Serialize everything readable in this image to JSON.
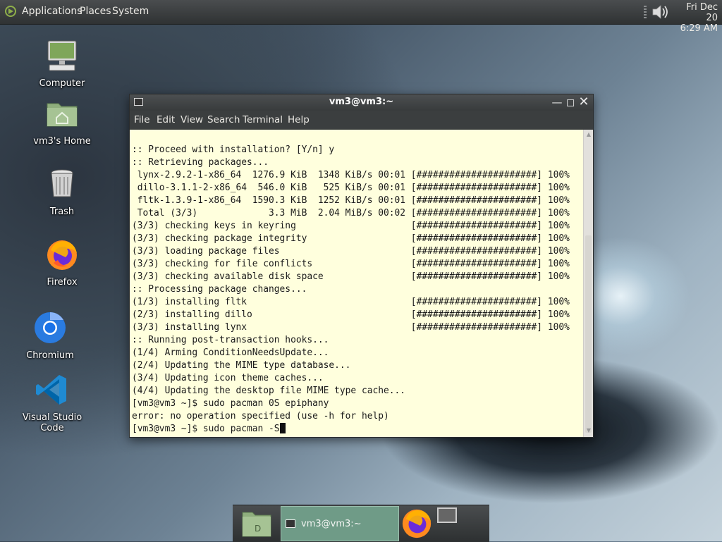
{
  "top_panel": {
    "menus": [
      "Applications",
      "Places",
      "System"
    ],
    "clock_day": "Fri Dec 20",
    "clock_time": "6:29 AM"
  },
  "desktop_icons": [
    {
      "label": "Computer",
      "icon": "computer-icon"
    },
    {
      "label": "vm3's Home",
      "icon": "home-folder-icon"
    },
    {
      "label": "Trash",
      "icon": "trash-icon"
    },
    {
      "label": "Firefox",
      "icon": "firefox-icon"
    },
    {
      "label": "Chromium",
      "icon": "chromium-icon"
    },
    {
      "label": "Visual Studio Code",
      "icon": "vscode-icon"
    }
  ],
  "terminal": {
    "title": "vm3@vm3:~",
    "menu": [
      "File",
      "Edit",
      "View",
      "Search",
      "Terminal",
      "Help"
    ],
    "lines": [
      ":: Proceed with installation? [Y/n] y",
      ":: Retrieving packages...",
      " lynx-2.9.2-1-x86_64  1276.9 KiB  1348 KiB/s 00:01 [######################] 100%",
      " dillo-3.1.1-2-x86_64  546.0 KiB   525 KiB/s 00:01 [######################] 100%",
      " fltk-1.3.9-1-x86_64  1590.3 KiB  1252 KiB/s 00:01 [######################] 100%",
      " Total (3/3)             3.3 MiB  2.04 MiB/s 00:02 [######################] 100%",
      "(3/3) checking keys in keyring                     [######################] 100%",
      "(3/3) checking package integrity                   [######################] 100%",
      "(3/3) loading package files                        [######################] 100%",
      "(3/3) checking for file conflicts                  [######################] 100%",
      "(3/3) checking available disk space                [######################] 100%",
      ":: Processing package changes...",
      "(1/3) installing fltk                              [######################] 100%",
      "(2/3) installing dillo                             [######################] 100%",
      "(3/3) installing lynx                              [######################] 100%",
      ":: Running post-transaction hooks...",
      "(1/4) Arming ConditionNeedsUpdate...",
      "(2/4) Updating the MIME type database...",
      "(3/4) Updating icon theme caches...",
      "(4/4) Updating the desktop file MIME type cache...",
      "[vm3@vm3 ~]$ sudo pacman 0S epiphany",
      "error: no operation specified (use -h for help)"
    ],
    "prompt": "[vm3@vm3 ~]$ sudo pacman -S"
  },
  "taskbar": {
    "window_label": "vm3@vm3:~"
  },
  "colors": {
    "terminal_bg": "#ffffdd",
    "panel_bg": "#3a3d3e",
    "task_active": "#6f9b87"
  }
}
